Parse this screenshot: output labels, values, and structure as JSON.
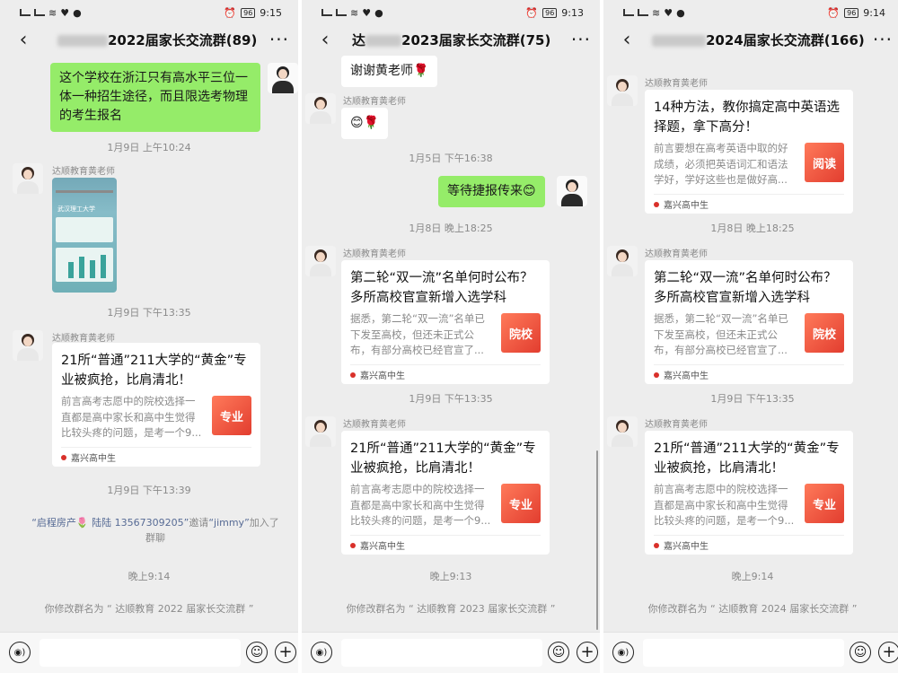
{
  "status": {
    "p1_time": "9:15",
    "p2_time": "9:13",
    "p3_time": "9:14",
    "battery": "96"
  },
  "panel1": {
    "title": "2022届家长交流群(89)",
    "msg_out": "这个学校在浙江只有高水平三位一体一种招生途径，而且限选考物理的考生报名",
    "ts1": "1月9日 上午10:24",
    "sender": "达顺教育黄老师",
    "poster_text": "武汉理工大学",
    "ts2": "1月9日 下午13:35",
    "card_title": "21所“普通”211大学的“黄金”专业被疯抢，比肩清北！",
    "card_desc": "前言高考志愿中的院校选择一直都是高中家长和高中生觉得比较头疼的问题，是考一个9...",
    "card_thumb": "专业",
    "card_source": "嘉兴高中生",
    "ts3": "1月9日 下午13:39",
    "sys_link1": "“启程房产🌷 陆陆 13567309205”",
    "sys_mid": "邀请",
    "sys_link2": "“jimmy”",
    "sys_end": "加入了群聊",
    "ts4": "晚上9:14",
    "rename": "你修改群名为 “ 达顺教育 2022 届家长交流群 ”"
  },
  "panel2": {
    "title": "2023届家长交流群(75)",
    "title_prefix": "达",
    "msg_thanks": "谢谢黄老师🌹",
    "sender": "达顺教育黄老师",
    "msg_emoji": "😊🌹",
    "ts1": "1月5日 下午16:38",
    "msg_out": "等待捷报传来😊",
    "ts2": "1月8日 晚上18:25",
    "card1_title": "第二轮“双一流”名单何时公布？多所高校官宣新增入选学科",
    "card1_desc": "据悉，第二轮“双一流”名单已下发至高校，但还未正式公布，有部分高校已经官宣了...",
    "card1_thumb": "院校",
    "card_source": "嘉兴高中生",
    "ts3": "1月9日 下午13:35",
    "card2_title": "21所“普通”211大学的“黄金”专业被疯抢，比肩清北！",
    "card2_desc": "前言高考志愿中的院校选择一直都是高中家长和高中生觉得比较头疼的问题，是考一个9...",
    "card2_thumb": "专业",
    "ts4": "晚上9:13",
    "rename": "你修改群名为 “ 达顺教育 2023 届家长交流群 ”"
  },
  "panel3": {
    "title": "2024届家长交流群(166)",
    "sender": "达顺教育黄老师",
    "card1_title": "14种方法，教你搞定高中英语选择题，拿下高分！",
    "card1_desc": "前言要想在高考英语中取的好成绩，必须把英语词汇和语法学好，学好这些也是做好高...",
    "card1_thumb": "阅读",
    "card_source": "嘉兴高中生",
    "ts1": "1月8日 晚上18:25",
    "card2_title": "第二轮“双一流”名单何时公布？多所高校官宣新增入选学科",
    "card2_desc": "据悉，第二轮“双一流”名单已下发至高校，但还未正式公布，有部分高校已经官宣了...",
    "card2_thumb": "院校",
    "ts2": "1月9日 下午13:35",
    "card3_title": "21所“普通”211大学的“黄金”专业被疯抢，比肩清北！",
    "card3_desc": "前言高考志愿中的院校选择一直都是高中家长和高中生觉得比较头疼的问题，是考一个9...",
    "card3_thumb": "专业",
    "ts3": "晚上9:14",
    "rename": "你修改群名为 “ 达顺教育 2024 届家长交流群 ”"
  },
  "icons": {
    "back": "back-arrow-icon",
    "more": "more-icon",
    "voice": "voice-icon",
    "emoji": "emoji-icon",
    "plus": "plus-icon"
  },
  "colors": {
    "chat_bg": "#ededed",
    "outgoing_bubble": "#95ec69",
    "incoming_bubble": "#ffffff",
    "link": "#576b95",
    "thumb_red": "#e23d2f"
  }
}
